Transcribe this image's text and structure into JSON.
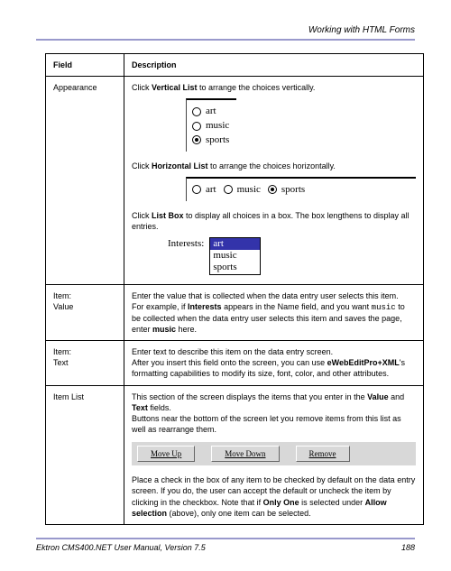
{
  "header": {
    "section_title": "Working with HTML Forms"
  },
  "table": {
    "col_field": "Field",
    "col_desc": "Description",
    "rows": {
      "appearance": {
        "field": "Appearance",
        "vlist_pre": "Click ",
        "vlist_bold": "Vertical List",
        "vlist_post": " to arrange the choices vertically.",
        "hlist_pre": "Click ",
        "hlist_bold": "Horizontal List",
        "hlist_post": " to arrange the choices horizontally.",
        "lbox_pre": "Click ",
        "lbox_bold": "List Box",
        "lbox_post": " to display all choices in a box. The box lengthens to display all entries.",
        "radio_art": "art",
        "radio_music": "music",
        "radio_sports": "sports",
        "interests_label": "Interests:"
      },
      "item_value": {
        "field1": "Item:",
        "field2": "Value",
        "line1": "Enter the value that is collected when the data entry user selects this item.",
        "line2a": "For example, if ",
        "line2b": "Interests",
        "line2c": " appears in the Name field, and you want ",
        "line2d": "music",
        "line2e": " to be collected when the data entry user selects this item and saves the page, enter ",
        "line2f": "music",
        "line2g": " here."
      },
      "item_text": {
        "field1": "Item:",
        "field2": "Text",
        "line1": "Enter text to describe this item on the data entry screen.",
        "line2a": "After you insert this field onto the screen, you can use ",
        "line2b": "eWebEditPro+XML",
        "line2c": "'s formatting capabilities to modify its size, font, color, and other attributes."
      },
      "item_list": {
        "field": "Item List",
        "line1a": "This section of the screen displays the items that you enter in the ",
        "line1b": "Value",
        "line1c": " and ",
        "line1d": "Text",
        "line1e": " fields.",
        "line2": "Buttons near the bottom of the screen let you remove items from this list as well as rearrange them.",
        "btn_up": "Move Up",
        "btn_down": "Move Down",
        "btn_remove": "Remove",
        "line3a": "Place a check in the box of any item to be checked by default on the data entry screen. If you do, the user can accept the default or uncheck the item by clicking in the checkbox. Note that if ",
        "line3b": "Only One",
        "line3c": " is selected under ",
        "line3d": "Allow selection",
        "line3e": " (above), only one item can be selected."
      }
    }
  },
  "footer": {
    "manual": "Ektron CMS400.NET User Manual, Version 7.5",
    "page": "188"
  }
}
